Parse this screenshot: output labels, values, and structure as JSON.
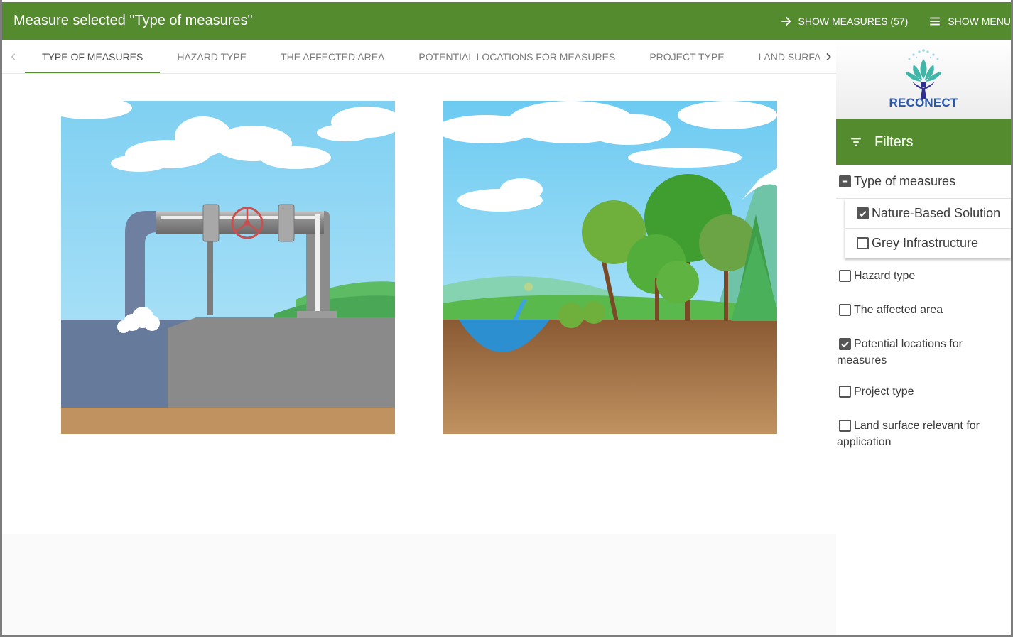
{
  "header": {
    "title": "Measure selected \"Type of measures\"",
    "show_measures": "SHOW MEASURES (57)",
    "show_menu": "SHOW MENU",
    "color": "#558b2f"
  },
  "tabs": [
    {
      "label": "TYPE OF MEASURES",
      "active": true
    },
    {
      "label": "HAZARD TYPE"
    },
    {
      "label": "THE AFFECTED AREA"
    },
    {
      "label": "POTENTIAL LOCATIONS FOR MEASURES"
    },
    {
      "label": "PROJECT TYPE"
    },
    {
      "label": "LAND SURFACE RELEVANT FOR APPLICATION"
    }
  ],
  "sidebar": {
    "logo_text": "RECONECT",
    "filters_title": "Filters",
    "group": {
      "label": "Type of measures",
      "items": [
        {
          "label": "Nature-Based Solution",
          "checked": true
        },
        {
          "label": "Grey Infrastructure",
          "checked": false
        }
      ]
    },
    "items": [
      {
        "line1": "Hazard type",
        "line2": "",
        "checked": false
      },
      {
        "line1": "The affected area",
        "line2": "",
        "checked": false
      },
      {
        "line1": "Potential locations for",
        "line2": "measures",
        "checked": true
      },
      {
        "line1": "Project type",
        "line2": "",
        "checked": false
      },
      {
        "line1": "Land surface relevant for",
        "line2": "application",
        "checked": false
      }
    ]
  }
}
